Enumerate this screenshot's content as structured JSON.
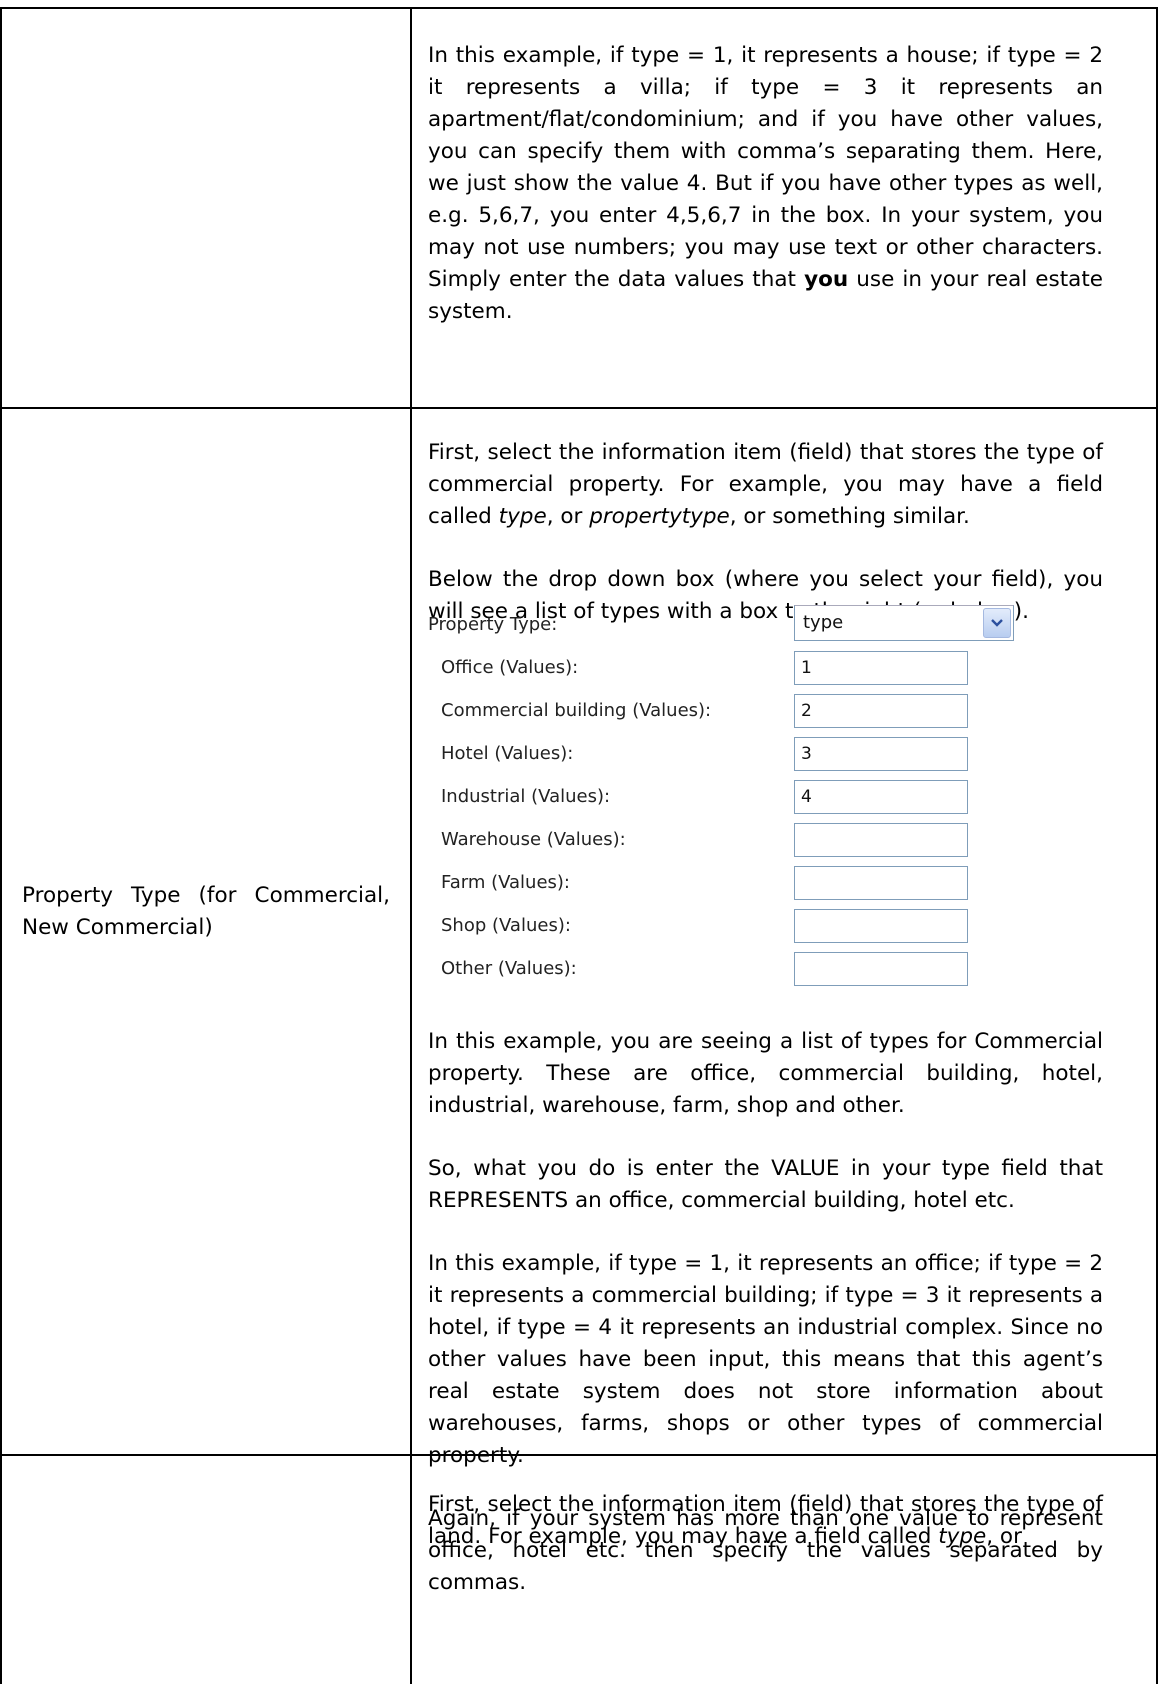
{
  "row1": {
    "para": [
      "In this example, if type = 1, it represents a house; if type = 2 it represents a villa; if type = 3 it represents an apartment/flat/condominium; and if you have other values, you can specify them with comma’s separating them. Here, we just show the value 4. But if you have other types as well, e.g. 5,6,7, you enter 4,5,6,7 in the box. In your system, you may not use numbers; you may use text or other characters. Simply enter the data values that ",
      "you",
      " use in your real estate system."
    ]
  },
  "row2": {
    "label": "Property Type (for Commercial, New Commercial)",
    "intro_a": "First, select the information item (field) that stores the type of commercial property. For example, you may have a field called ",
    "intro_em1": "type",
    "intro_b": ", or ",
    "intro_em2": "propertytype",
    "intro_c": ", or something similar.",
    "below": "Below the drop down box (where you select your field), you will see a list of types with a box to the right (or below).",
    "form": {
      "property_type_label": "Property Type:",
      "property_type_value": "type",
      "fields": [
        {
          "label": "Office (Values):",
          "value": "1"
        },
        {
          "label": "Commercial building (Values):",
          "value": "2"
        },
        {
          "label": "Hotel (Values):",
          "value": "3"
        },
        {
          "label": "Industrial (Values):",
          "value": "4"
        },
        {
          "label": "Warehouse (Values):",
          "value": ""
        },
        {
          "label": "Farm (Values):",
          "value": ""
        },
        {
          "label": "Shop (Values):",
          "value": ""
        },
        {
          "label": "Other (Values):",
          "value": ""
        }
      ]
    },
    "para_list": "In this example, you are seeing a list of types for Commercial property.  These are office, commercial building, hotel, industrial, warehouse, farm, shop and other.",
    "para_value": "So, what you do is enter the VALUE in your type field that REPRESENTS an office, commercial building, hotel etc.",
    "para_example": "In this example, if type = 1, it represents an office; if type = 2 it represents a commercial building; if type = 3 it represents a hotel, if type = 4 it represents an industrial complex.  Since no other values have been input, this means that this agent’s real estate system does not store information about warehouses, farms, shops or other types of commercial property.",
    "para_again": "Again, if your system has more than one value to represent office, hotel etc. then specify the values separated by commas."
  },
  "row3": {
    "intro_a": "First, select the information item (field) that stores the type of land. For example, you may have a field called ",
    "intro_em1": "type",
    "intro_b": ", or"
  }
}
